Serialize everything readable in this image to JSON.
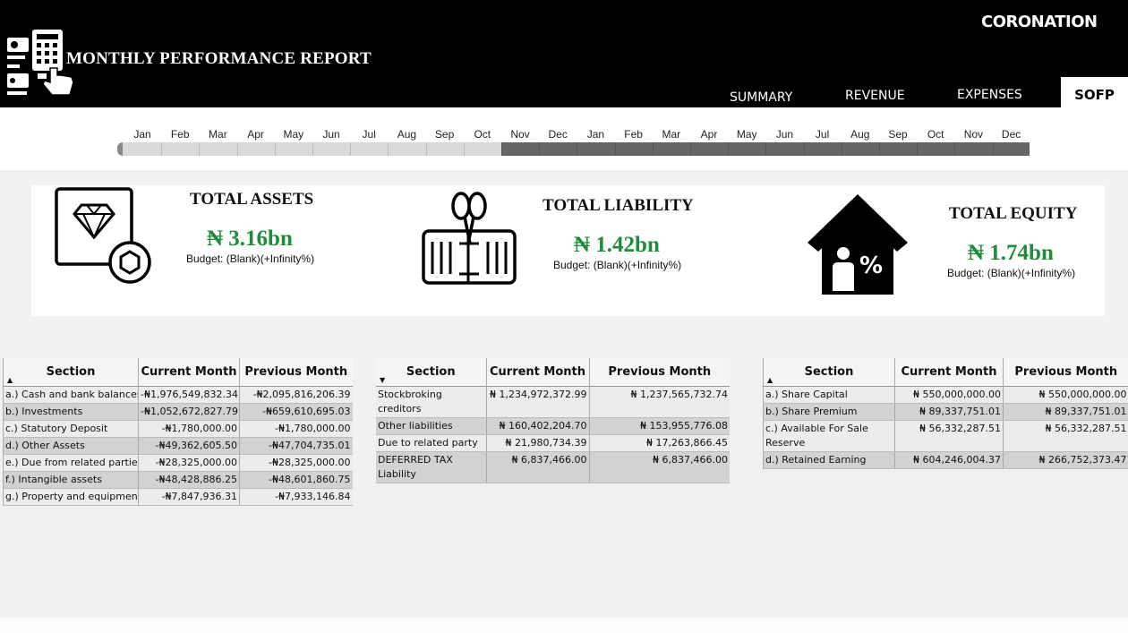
{
  "header": {
    "title": "MONTHLY PERFORMANCE REPORT",
    "brand": "CORONATION",
    "tabs": {
      "summary": "SUMMARY",
      "revenue": "REVENUE",
      "expenses": "EXPENSES",
      "sofp": "SOFP"
    },
    "active_tab": "SOFP"
  },
  "timeline": {
    "months": [
      "Jan",
      "Feb",
      "Mar",
      "Apr",
      "May",
      "Jun",
      "Jul",
      "Aug",
      "Sep",
      "Oct",
      "Nov",
      "Dec",
      "Jan",
      "Feb",
      "Mar",
      "Apr",
      "May",
      "Jun",
      "Jul",
      "Aug",
      "Sep",
      "Oct",
      "Nov",
      "Dec"
    ],
    "selected_range": {
      "start_index": 0,
      "end_index": 9
    }
  },
  "kpis": {
    "assets": {
      "title": "TOTAL ASSETS",
      "value": "₦ 3.16bn",
      "budget": "Budget: (Blank)(+Infinity%)",
      "icon": "diamond-icon"
    },
    "liability": {
      "title": "TOTAL LIABILITY",
      "value": "₦ 1.42bn",
      "budget": "Budget: (Blank)(+Infinity%)",
      "icon": "scissors-money-icon"
    },
    "equity": {
      "title": "TOTAL EQUITY",
      "value": "₦ 1.74bn",
      "budget": "Budget: (Blank)(+Infinity%)",
      "icon": "house-percent-icon"
    }
  },
  "tables": {
    "columns": {
      "section": "Section",
      "current": "Current Month",
      "previous": "Previous Month"
    },
    "assets": [
      {
        "section": "a.) Cash and bank balances",
        "current": "-₦1,976,549,832.34",
        "previous": "-₦2,095,816,206.39"
      },
      {
        "section": "b.) Investments",
        "current": "-₦1,052,672,827.79",
        "previous": "-₦659,610,695.03"
      },
      {
        "section": "c.) Statutory Deposit",
        "current": "-₦1,780,000.00",
        "previous": "-₦1,780,000.00"
      },
      {
        "section": "d.) Other Assets",
        "current": "-₦49,362,605.50",
        "previous": "-₦47,704,735.01"
      },
      {
        "section": "e.) Due from related parties",
        "current": "-₦28,325,000.00",
        "previous": "-₦28,325,000.00"
      },
      {
        "section": "f.) Intangible assets",
        "current": "-₦48,428,886.25",
        "previous": "-₦48,601,860.75"
      },
      {
        "section": "g.) Property and equipment",
        "current": "-₦7,847,936.31",
        "previous": "-₦7,933,146.84"
      }
    ],
    "liabilities": [
      {
        "section": "Stockbroking creditors",
        "current": "₦ 1,234,972,372.99",
        "previous": "₦ 1,237,565,732.74"
      },
      {
        "section": "Other liabilities",
        "current": "₦ 160,402,204.70",
        "previous": "₦ 153,955,776.08"
      },
      {
        "section": "Due to related party",
        "current": "₦ 21,980,734.39",
        "previous": "₦ 17,263,866.45"
      },
      {
        "section": "DEFERRED TAX Liability",
        "current": "₦ 6,837,466.00",
        "previous": "₦ 6,837,466.00"
      }
    ],
    "equity": [
      {
        "section": "a.) Share Capital",
        "current": "₦ 550,000,000.00",
        "previous": "₦ 550,000,000.00"
      },
      {
        "section": "b.) Share Premium",
        "current": "₦ 89,337,751.01",
        "previous": "₦ 89,337,751.01"
      },
      {
        "section": "c.) Available For Sale Reserve",
        "current": "₦ 56,332,287.51",
        "previous": "₦ 56,332,287.51"
      },
      {
        "section": "d.) Retained Earning",
        "current": "₦ 604,246,004.37",
        "previous": "₦ 266,752,373.47"
      }
    ]
  },
  "colors": {
    "header_bg": "#000000",
    "value_green": "#1e8c3a",
    "panel_bg": "#f1f1f1",
    "row_light": "#ececec",
    "row_dark": "#d2d2d2"
  }
}
